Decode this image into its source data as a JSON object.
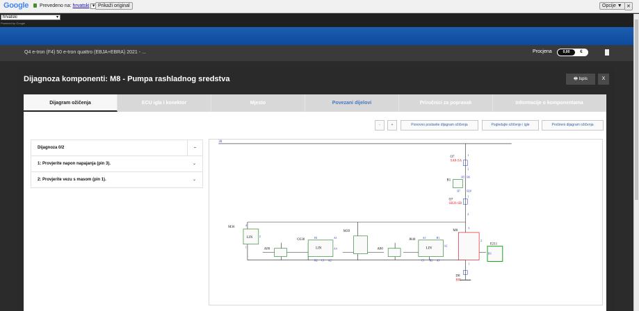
{
  "google_bar": {
    "logo": "Google",
    "translated_to": "Prevedeno na:",
    "language_link": "hrvatski",
    "dropdown_glyph": "▼",
    "show_original": "Prikaži original",
    "options": "Opcije ▼",
    "close": "✕"
  },
  "language_select": {
    "value": "hrvatski",
    "powered_by": "Powered by Google"
  },
  "top_bar": {
    "vehicle": "Q4 e-tron (F4) 50 e-tron quattro (EBJA+EBRA) 2021 - ...",
    "estimate_label": "Procjena",
    "estimate_value": "0,00",
    "currency": "€"
  },
  "dialog": {
    "title": "Dijagnoza komponenti: M8 - Pumpa rashladnog sredstva",
    "print_label": "Ispis",
    "close_label": "X"
  },
  "tabs": [
    {
      "label": "Dijagram ožičenja"
    },
    {
      "label": "ECU igla i konektor"
    },
    {
      "label": "Mjesto"
    },
    {
      "label": "Povezani dijelovi"
    },
    {
      "label": "Priručnici za popravak"
    },
    {
      "label": "Informacije o komponentama"
    }
  ],
  "toolbar": {
    "zoom_out": "-",
    "zoom_in": "+",
    "reset": "Ponovno postavite dijagram ožičenja",
    "view_wiring": "Pogledajte ožičenje i igle",
    "expanded": "Prošireni dijagram ožičenja"
  },
  "diagnosis": {
    "header": "Dijagnoza 0/2",
    "collapse": "–",
    "steps": [
      {
        "label": "1: Provjerite napon napajanja (pin 3).",
        "chevron": "⌄"
      },
      {
        "label": "2: Provjerite vezu s masom (pin 1).",
        "chevron": "⌄"
      }
    ]
  },
  "wiring": {
    "bus_label": "30",
    "components": [
      {
        "id": "O7",
        "sub": "SA8-SA"
      },
      {
        "id": "B1"
      },
      {
        "id": "O7",
        "sub": "SB26-SB"
      },
      {
        "id": "M36"
      },
      {
        "id": "A80"
      },
      {
        "id": "O330"
      },
      {
        "id": "M39"
      },
      {
        "id": "A80"
      },
      {
        "id": "J840"
      },
      {
        "id": "M8"
      },
      {
        "id": "E211"
      },
      {
        "id": "D8",
        "sub": "B85"
      }
    ],
    "pins": [
      "1",
      "2",
      "3",
      "4",
      "A1",
      "A2",
      "A3",
      "A4",
      "B1",
      "B2",
      "B3",
      "C1",
      "B6",
      "B5",
      "B7",
      "B20",
      "M"
    ],
    "connector_label": "LIN"
  },
  "colors": {
    "accent": "#1c5eb0",
    "active_tab_text": "#222222",
    "link_blue": "#4678c3",
    "wire_blue": "#1f33c4",
    "wire_red": "#d22"
  }
}
